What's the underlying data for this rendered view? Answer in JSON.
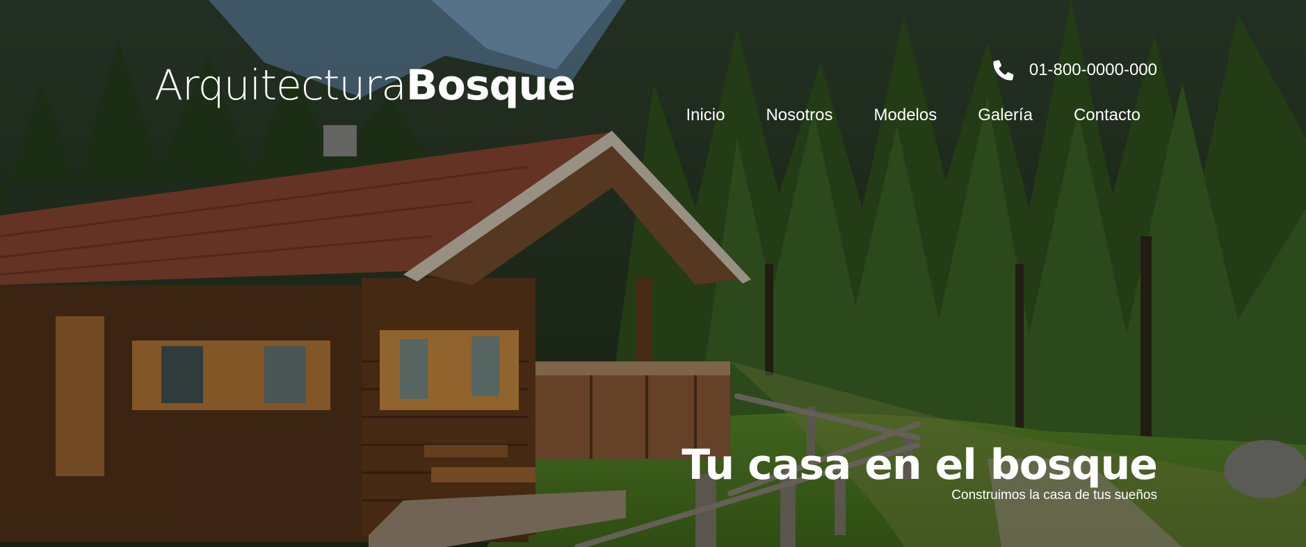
{
  "brand": {
    "name_light": "Arquitectura",
    "name_bold": "Bosque"
  },
  "contact": {
    "icon": "phone-icon",
    "phone": "01-800-0000-000"
  },
  "nav": {
    "items": [
      {
        "label": "Inicio"
      },
      {
        "label": "Nosotros"
      },
      {
        "label": "Modelos"
      },
      {
        "label": "Galería"
      },
      {
        "label": "Contacto"
      }
    ]
  },
  "hero": {
    "title": "Tu casa en el bosque",
    "subtitle": "Construimos la casa de tus sueños"
  },
  "colors": {
    "text": "#ffffff",
    "forest": "#2f4a1c",
    "roof": "#6e3a2a",
    "wood": "#6b4020",
    "grass": "#5c8a2a"
  }
}
